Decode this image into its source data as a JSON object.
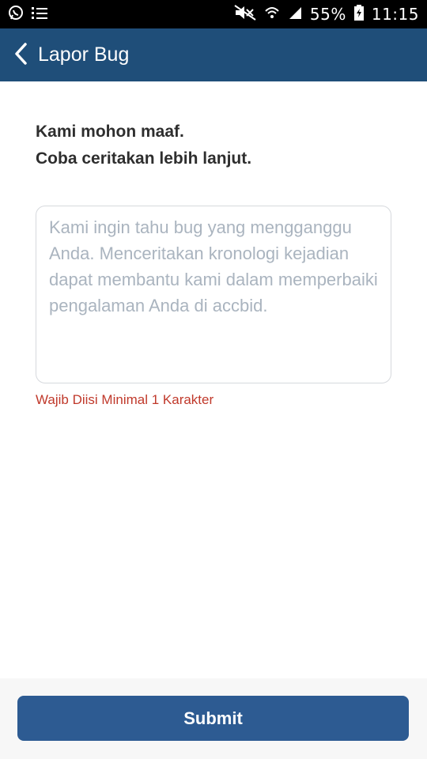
{
  "status_bar": {
    "battery": "55%",
    "time": "11:15",
    "icons": [
      "whatsapp-icon",
      "list-icon",
      "mute-icon",
      "wifi-icon",
      "signal-icon",
      "battery-icon"
    ]
  },
  "app_bar": {
    "title": "Lapor Bug",
    "background": "#1f4e79"
  },
  "intro": {
    "line1": "Kami mohon maaf.",
    "line2": "Coba ceritakan lebih lanjut."
  },
  "report_field": {
    "value": "",
    "placeholder": "Kami ingin tahu bug yang mengganggu Anda. Menceritakan kronologi kejadian dapat membantu kami dalam memperbaiki pengalaman Anda di accbid."
  },
  "validation": {
    "error": "Wajib Diisi Minimal 1 Karakter",
    "color": "#c0392b"
  },
  "actions": {
    "submit_label": "Submit",
    "submit_color": "#2d5b92"
  }
}
